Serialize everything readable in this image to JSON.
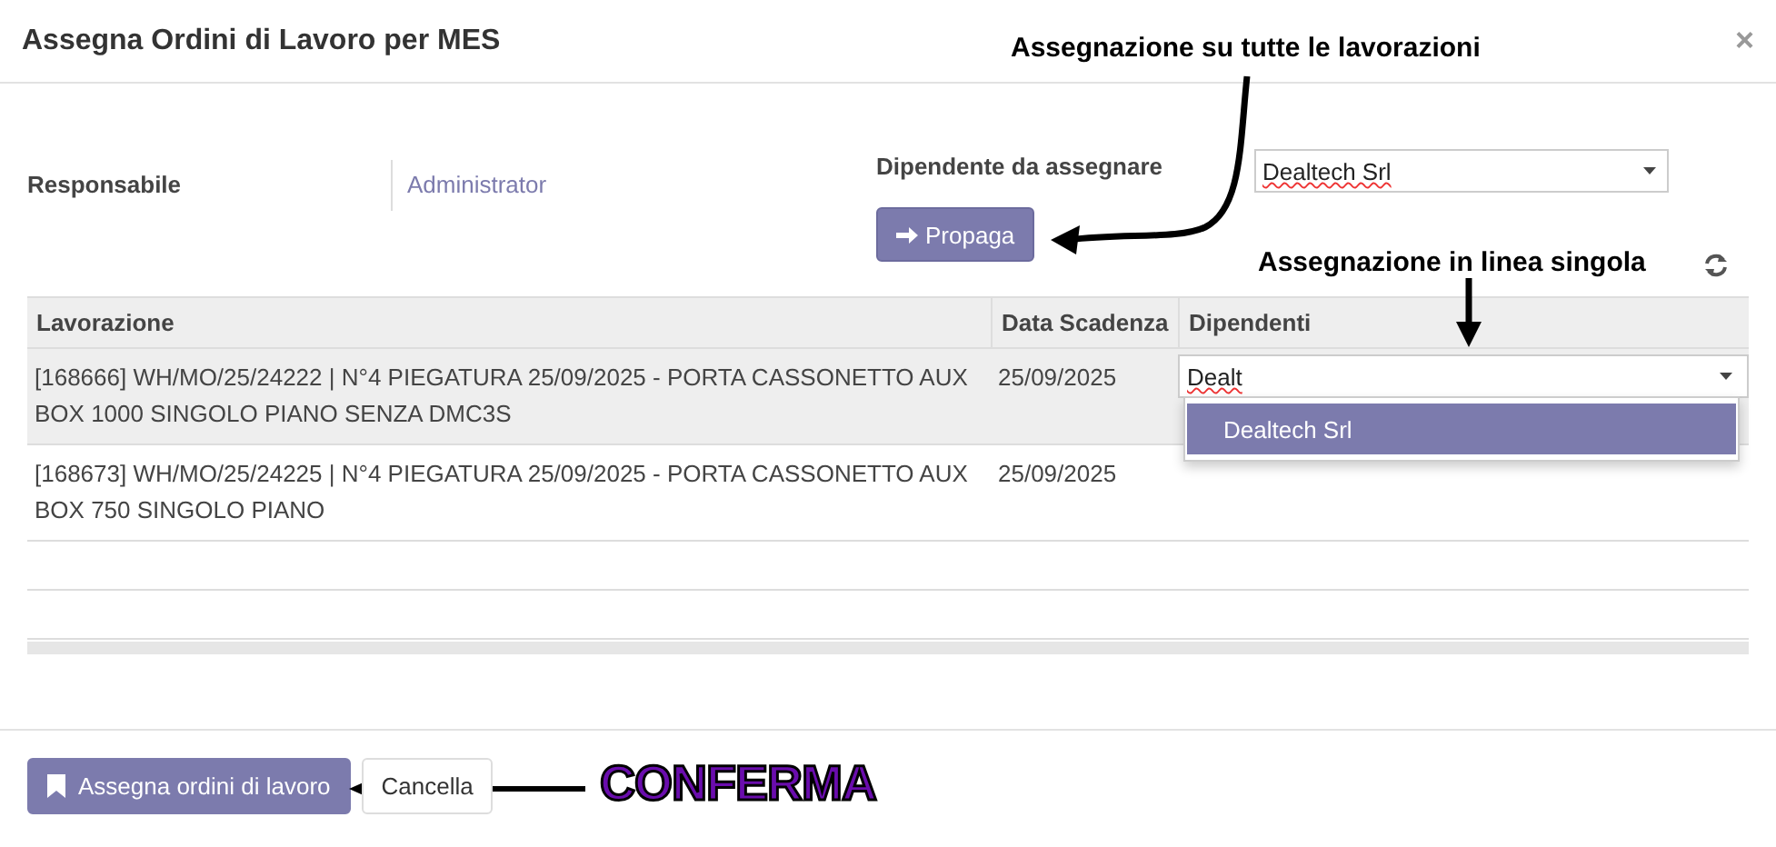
{
  "window": {
    "title": "Assegna Ordini di Lavoro per MES",
    "close": "×"
  },
  "form": {
    "responsabile": {
      "label": "Responsabile",
      "value": "Administrator"
    },
    "dipendente": {
      "label": "Dipendente da assegnare",
      "value": "Dealtech Srl"
    },
    "propaga": "Propaga"
  },
  "table": {
    "columns": [
      "Lavorazione",
      "Data Scadenza",
      "Dipendenti"
    ],
    "rows": [
      {
        "selected": true,
        "lavorazione": "[168666] WH/MO/25/24222 | N°4 PIEGATURA 25/09/2025 - PORTA CASSONETTO AUX BOX 1000 SINGOLO PIANO SENZA DMC3S",
        "scadenza": "25/09/2025",
        "dipendente": "Dealt",
        "editing": true
      },
      {
        "selected": false,
        "lavorazione": "[168673] WH/MO/25/24225 | N°4 PIEGATURA 25/09/2025 - PORTA CASSONETTO AUX BOX 750 SINGOLO PIANO",
        "scadenza": "25/09/2025",
        "dipendente": "",
        "editing": false
      }
    ],
    "suggestions": [
      {
        "label": "Dealtech Srl",
        "highlighted": true
      }
    ]
  },
  "footer": {
    "buttons": [
      {
        "kind": "primary",
        "label": "Assegna ordini di lavoro"
      },
      {
        "kind": "secondary",
        "label": "Cancella"
      }
    ]
  },
  "annotations": [
    {
      "kind": "curved",
      "text": "Assegnazione su tutte le lavorazioni"
    },
    {
      "kind": "down",
      "text": "Assegnazione in linea singola"
    },
    {
      "kind": "left",
      "text": "CONFERMA"
    }
  ]
}
